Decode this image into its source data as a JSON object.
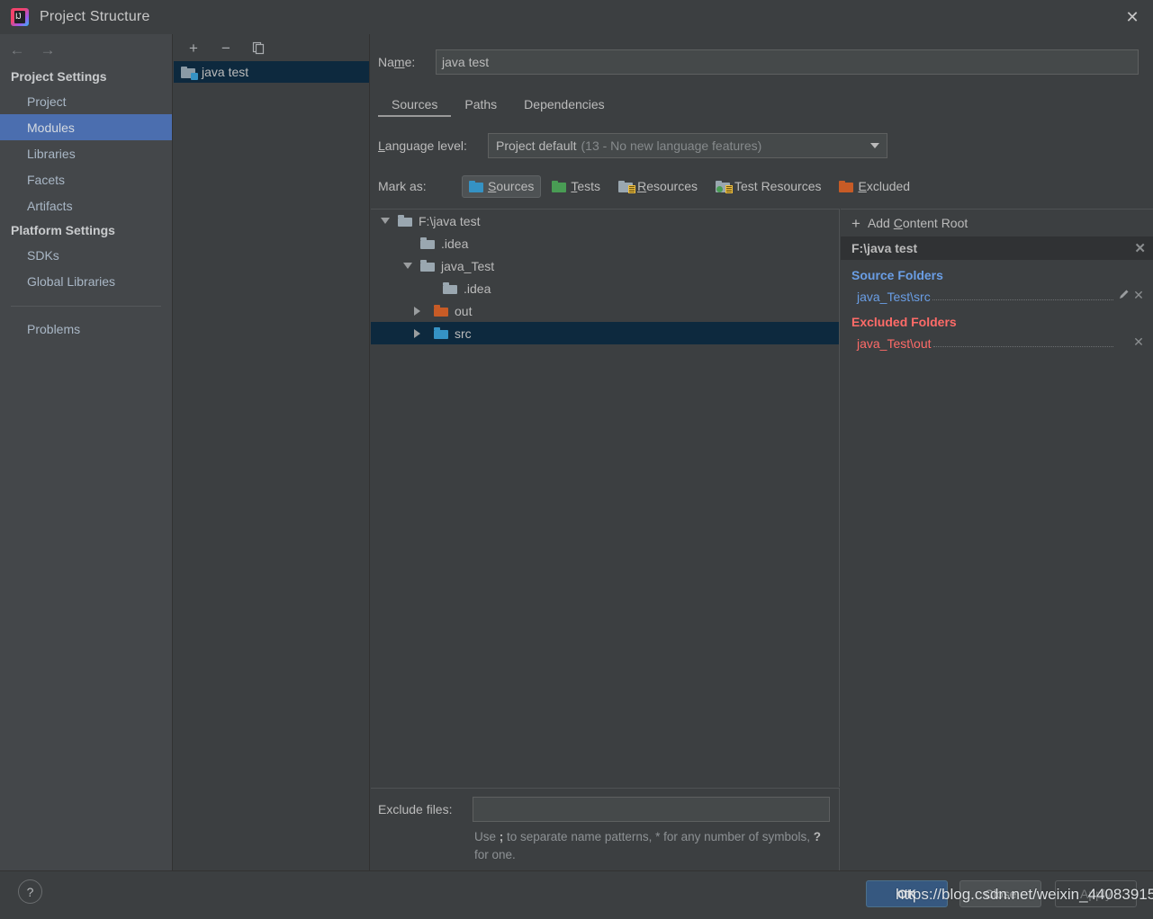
{
  "window": {
    "title": "Project Structure",
    "app_icon": "intellij-idea-icon",
    "close_label": "✕"
  },
  "sidebar": {
    "back_arrow": "←",
    "forward_arrow": "→",
    "groups": [
      {
        "label": "Project Settings",
        "items": [
          {
            "label": "Project",
            "selected": false
          },
          {
            "label": "Modules",
            "selected": true
          },
          {
            "label": "Libraries",
            "selected": false
          },
          {
            "label": "Facets",
            "selected": false
          },
          {
            "label": "Artifacts",
            "selected": false
          }
        ]
      },
      {
        "label": "Platform Settings",
        "items": [
          {
            "label": "SDKs",
            "selected": false
          },
          {
            "label": "Global Libraries",
            "selected": false
          }
        ]
      }
    ],
    "problems_label": "Problems"
  },
  "modules": {
    "toolbar": {
      "add_label": "+",
      "remove_label": "−",
      "copy_label": "copy-icon"
    },
    "items": [
      {
        "label": "java test",
        "icon": "module-folder-icon",
        "selected": true
      }
    ]
  },
  "details": {
    "name_label_pre": "Na",
    "name_label_accel": "m",
    "name_label_post": "e:",
    "name_value": "java test",
    "tabs": [
      {
        "label": "Sources",
        "active": true
      },
      {
        "label": "Paths",
        "active": false
      },
      {
        "label": "Dependencies",
        "active": false
      }
    ],
    "language_level": {
      "label_accel": "L",
      "label_rest": "anguage level:",
      "value": "Project default",
      "value_detail": "(13 - No new language features)",
      "arrow": "chevron-down-icon"
    },
    "mark_as": {
      "label": "Mark as:",
      "buttons": [
        {
          "label_accel": "S",
          "label_rest": "ources",
          "icon": "folder-sources-icon",
          "color": "#3592c4",
          "active": true
        },
        {
          "label_accel": "T",
          "label_rest": "ests",
          "icon": "folder-tests-icon",
          "color": "#499c54",
          "active": false
        },
        {
          "label_accel": "R",
          "label_rest": "esources",
          "icon": "folder-resources-icon",
          "color": "#9aa7b0",
          "active": false
        },
        {
          "label_accel": "",
          "label_rest": "Test Resources",
          "icon": "folder-test-resources-icon",
          "color": "#9aa7b0",
          "active": false
        },
        {
          "label_accel": "E",
          "label_rest": "xcluded",
          "icon": "folder-excluded-icon",
          "color": "#c75b26",
          "active": false
        }
      ]
    },
    "tree": [
      {
        "label": "F:\\java test",
        "indent": 0,
        "twisty": "down",
        "color": "#9aa7b0",
        "selected": false
      },
      {
        "label": ".idea",
        "indent": 1,
        "twisty": "none",
        "color": "#9aa7b0",
        "selected": false
      },
      {
        "label": "java_Test",
        "indent": 1,
        "twisty": "down",
        "color": "#9aa7b0",
        "selected": false
      },
      {
        "label": ".idea",
        "indent": 2,
        "twisty": "none",
        "color": "#9aa7b0",
        "selected": false
      },
      {
        "label": "out",
        "indent": 2,
        "twisty": "right",
        "color": "#c75b26",
        "selected": false
      },
      {
        "label": "src",
        "indent": 2,
        "twisty": "right",
        "color": "#3592c4",
        "selected": true
      }
    ],
    "exclude": {
      "label": "Exclude files:",
      "value": "",
      "hint_1": "Use ",
      "hint_semicolon": ";",
      "hint_2": " to separate name patterns, * for any number of",
      "hint_3": "symbols, ",
      "hint_question": "?",
      "hint_4": " for one."
    }
  },
  "content_roots": {
    "add_label_pre": "Add ",
    "add_label_accel": "C",
    "add_label_post": "ontent Root",
    "plus": "+",
    "root_path": "F:\\java test",
    "root_close": "✕",
    "sections": [
      {
        "title": "Source Folders",
        "kind": "source",
        "items": [
          {
            "path": "java_Test\\src",
            "has_edit": true,
            "edit_icon": "pencil-icon",
            "close_icon": "✕"
          }
        ]
      },
      {
        "title": "Excluded Folders",
        "kind": "excluded",
        "items": [
          {
            "path": "java_Test\\out",
            "has_edit": false,
            "edit_icon": "",
            "close_icon": "✕"
          }
        ]
      }
    ]
  },
  "footer": {
    "help_label": "?",
    "ok_label": "OK",
    "close_label": "Close",
    "apply_label": "Apply",
    "watermark": "https://blog.csdn.net/weixin_44083915"
  },
  "colors": {
    "window_bg": "#3c3f41",
    "sidebar_bg": "#44474a",
    "selection_blue": "#4b6eaf",
    "tree_selection": "#0d293e",
    "source_blue": "#6a9ee5",
    "excluded_red": "#ff6b68",
    "ok_button": "#365880"
  }
}
